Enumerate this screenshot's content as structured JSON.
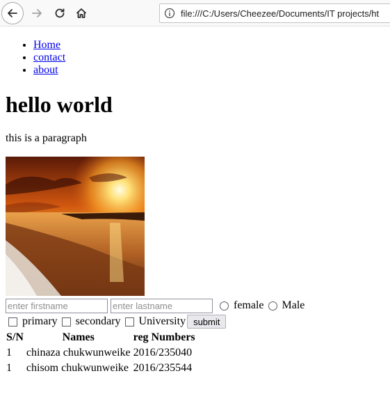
{
  "browser": {
    "url": "file:///C:/Users/Cheezee/Documents/IT projects/ht",
    "back_icon": "arrow-left-icon",
    "forward_icon": "arrow-right-icon",
    "reload_icon": "reload-icon",
    "home_icon": "home-icon",
    "info_icon": "info-icon"
  },
  "nav": {
    "items": [
      {
        "label": "Home"
      },
      {
        "label": "contact"
      },
      {
        "label": "about"
      }
    ]
  },
  "main": {
    "heading": "hello world",
    "paragraph": "this is a paragraph",
    "image": "sunset beach photo"
  },
  "form": {
    "firstname_placeholder": "enter firstname",
    "lastname_placeholder": "enter lastname",
    "radio_female": "female",
    "radio_male": "Male",
    "check_primary": "primary",
    "check_secondary": "secondary",
    "check_university": "University",
    "submit_label": "submit"
  },
  "table": {
    "headers": [
      "S/N",
      "Names",
      "reg Numbers"
    ],
    "rows": [
      [
        "1",
        "chinaza chukwunweike",
        "2016/235040"
      ],
      [
        "1",
        "chisom chukwunweike",
        "2016/235544"
      ]
    ]
  }
}
